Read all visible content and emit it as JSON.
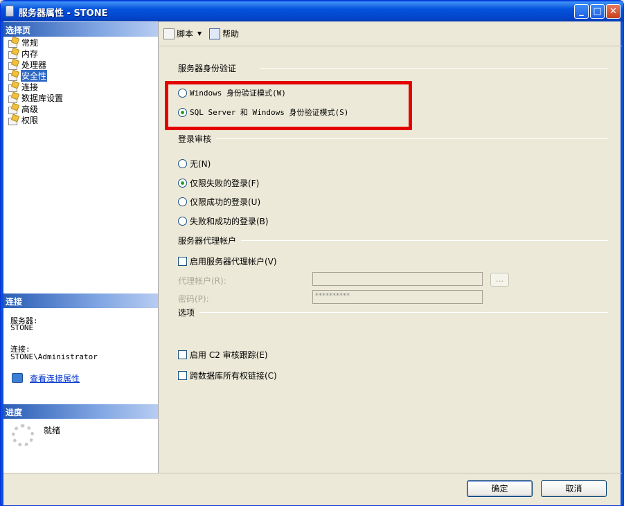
{
  "window": {
    "title": "服务器属性 - STONE"
  },
  "nav": {
    "header": "选择页",
    "items": [
      {
        "label": "常规"
      },
      {
        "label": "内存"
      },
      {
        "label": "处理器"
      },
      {
        "label": "安全性"
      },
      {
        "label": "连接"
      },
      {
        "label": "数据库设置"
      },
      {
        "label": "高级"
      },
      {
        "label": "权限"
      }
    ],
    "selected": "安全性"
  },
  "connection": {
    "header": "连接",
    "server_label": "服务器:",
    "server_value": "STONE",
    "conn_label": "连接:",
    "conn_value": "STONE\\Administrator",
    "link": "查看连接属性"
  },
  "progress": {
    "header": "进度",
    "status": "就绪"
  },
  "toolbar": {
    "script_label": "脚本",
    "help_label": "帮助"
  },
  "auth": {
    "title": "服务器身份验证",
    "options": [
      {
        "label": "Windows 身份验证模式(W)",
        "selected": false
      },
      {
        "label": "SQL Server 和 Windows 身份验证模式(S)",
        "selected": true
      }
    ]
  },
  "audit": {
    "title": "登录审核",
    "options": [
      {
        "label": "无(N)",
        "selected": false
      },
      {
        "label": "仅限失败的登录(F)",
        "selected": true
      },
      {
        "label": "仅限成功的登录(U)",
        "selected": false
      },
      {
        "label": "失败和成功的登录(B)",
        "selected": false
      }
    ]
  },
  "proxy": {
    "title": "服务器代理帐户",
    "enable_label": "启用服务器代理帐户(V)",
    "account_label": "代理帐户(R):",
    "account_value": "",
    "password_label": "密码(P):",
    "password_value": "**********",
    "browse_label": "..."
  },
  "options": {
    "title": "选项",
    "c2_label": "启用 C2 审核跟踪(E)",
    "cross_db_label": "跨数据库所有权链接(C)"
  },
  "buttons": {
    "ok": "确定",
    "cancel": "取消"
  },
  "colors": {
    "highlight_box": "#e50000",
    "titlebar": "#0453dd",
    "section_header": "#2a5db5"
  }
}
